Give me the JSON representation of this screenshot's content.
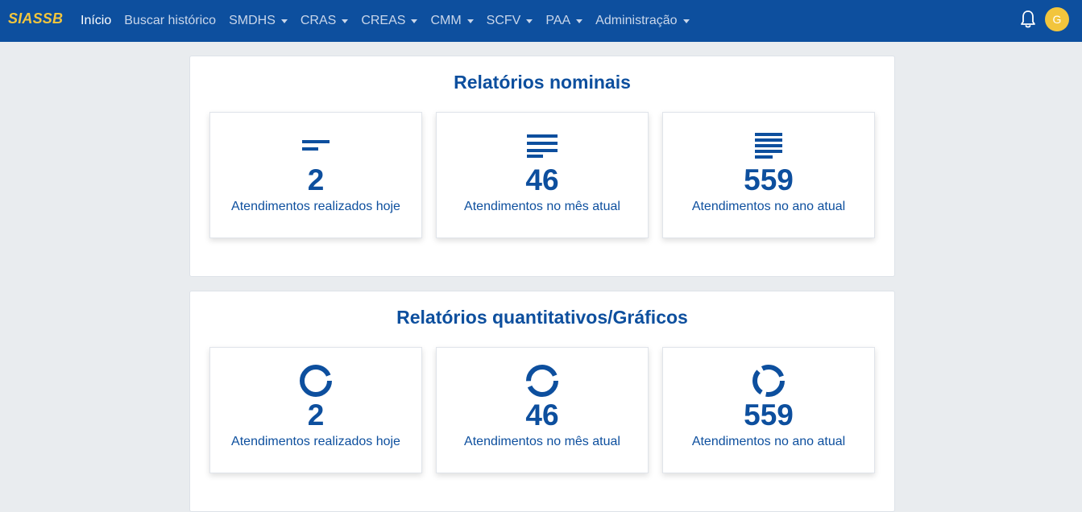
{
  "navbar": {
    "brand": "SIASSB",
    "items": [
      {
        "label": "Início",
        "dropdown": false,
        "active": true
      },
      {
        "label": "Buscar histórico",
        "dropdown": false,
        "active": false
      },
      {
        "label": "SMDHS",
        "dropdown": true,
        "active": false
      },
      {
        "label": "CRAS",
        "dropdown": true,
        "active": false
      },
      {
        "label": "CREAS",
        "dropdown": true,
        "active": false
      },
      {
        "label": "CMM",
        "dropdown": true,
        "active": false
      },
      {
        "label": "SCFV",
        "dropdown": true,
        "active": false
      },
      {
        "label": "PAA",
        "dropdown": true,
        "active": false
      },
      {
        "label": "Administração",
        "dropdown": true,
        "active": false
      }
    ],
    "notification_icon": "bell-icon",
    "avatar_initial": "G"
  },
  "colors": {
    "navbar_bg": "#0d4f9e",
    "brand": "#f2c53d",
    "accent_text": "#0d4f9e",
    "page_bg": "#e9ecef",
    "avatar_bg": "#f2c53d"
  },
  "nominal": {
    "title": "Relatórios nominais",
    "cards": [
      {
        "icon": "align-left-short-icon",
        "value": "2",
        "label": "Atendimentos realizados hoje"
      },
      {
        "icon": "align-left-icon",
        "value": "46",
        "label": "Atendimentos no mês atual"
      },
      {
        "icon": "align-justify-icon",
        "value": "559",
        "label": "Atendimentos no ano atual"
      }
    ]
  },
  "quantitative": {
    "title": "Relatórios quantitativos/Gráficos",
    "cards": [
      {
        "icon": "donut-chart-icon",
        "value": "2",
        "label": "Atendimentos realizados hoje"
      },
      {
        "icon": "donut-chart-icon",
        "value": "46",
        "label": "Atendimentos no mês atual"
      },
      {
        "icon": "donut-chart-icon",
        "value": "559",
        "label": "Atendimentos no ano atual"
      }
    ]
  }
}
